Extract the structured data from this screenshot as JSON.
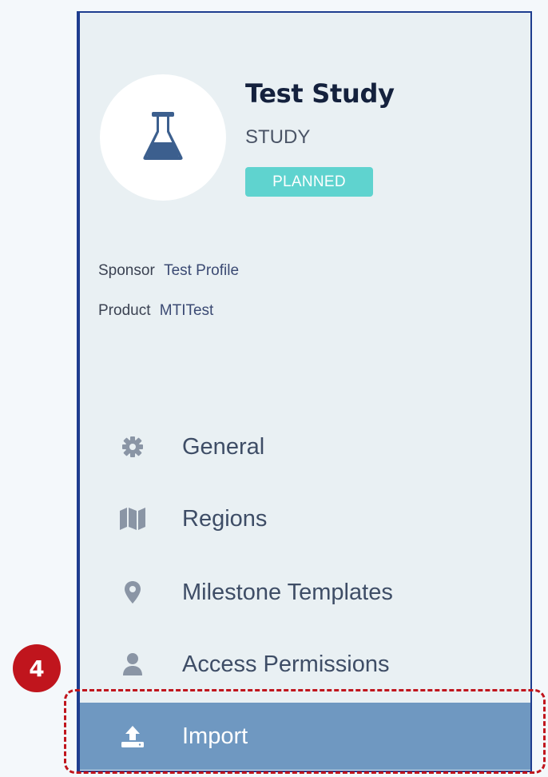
{
  "header": {
    "title": "Test Study",
    "type": "STUDY",
    "status": "PLANNED",
    "icon": "flask-icon"
  },
  "meta": {
    "sponsor_label": "Sponsor",
    "sponsor_value": "Test Profile",
    "product_label": "Product",
    "product_value": "MTITest"
  },
  "nav": {
    "items": [
      {
        "label": "General",
        "icon": "gear-icon"
      },
      {
        "label": "Regions",
        "icon": "map-icon"
      },
      {
        "label": "Milestone Templates",
        "icon": "map-pin-icon"
      },
      {
        "label": "Access Permissions",
        "icon": "user-icon"
      },
      {
        "label": "Import",
        "icon": "upload-icon",
        "active": true
      }
    ]
  },
  "annotation": {
    "step": "4"
  },
  "colors": {
    "panel_bg": "#e9f0f3",
    "panel_border": "#1e3d8f",
    "active_bg": "#6f98c1",
    "badge_bg": "#5fd3cf",
    "annotation_red": "#c0151d"
  }
}
